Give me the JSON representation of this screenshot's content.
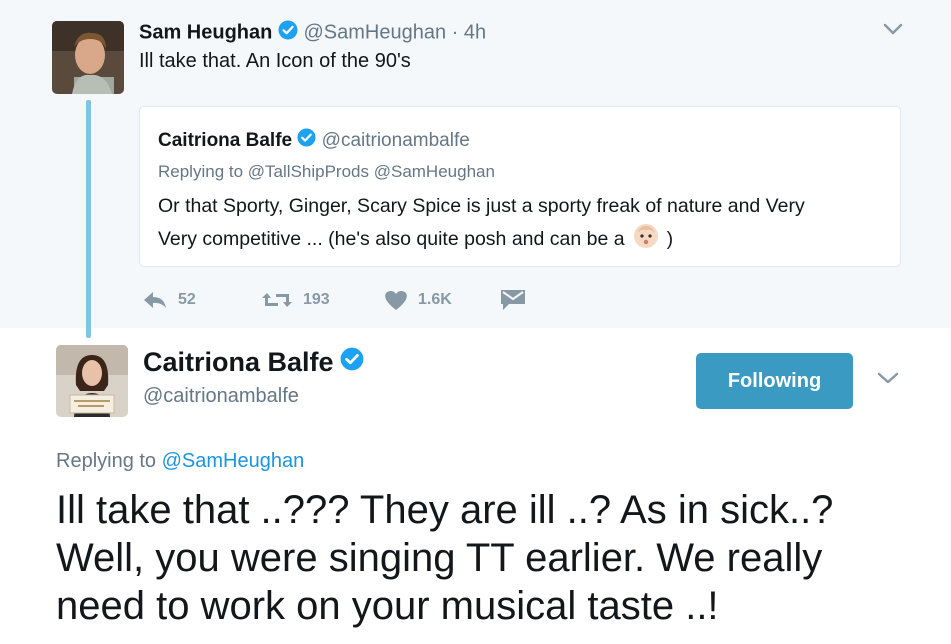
{
  "top_tweet": {
    "author_name": "Sam Heughan",
    "author_handle": "@SamHeughan",
    "time": "· 4h",
    "text": "Ill take that. An Icon of the 90's",
    "avatar_icon": "profile-photo-man"
  },
  "quoted_tweet": {
    "author_name": "Caitriona Balfe",
    "author_handle": "@caitrionambalfe",
    "replying_prefix": "Replying to",
    "replying_handles": "@TallShipProds @SamHeughan",
    "text_line1": "Or that Sporty, Ginger, Scary Spice is just a sporty freak of nature and Very",
    "text_line2": "Very competitive ... (he's also quite posh and can be a",
    "emoji_icon": "baby-face-emoji",
    "text_end": ")"
  },
  "actions": {
    "reply_count": "52",
    "retweet_count": "193",
    "like_count": "1.6K"
  },
  "main_tweet": {
    "author_name": "Caitriona Balfe",
    "author_handle": "@caitrionambalfe",
    "follow_label": "Following",
    "replying_prefix": "Replying to",
    "replying_handle": "@SamHeughan",
    "text_line1": "Ill take that ..??? They are ill ..? As in sick..?",
    "text_line2": "Well, you were singing TT earlier. We really",
    "text_line3": "need to work on your musical taste ..!",
    "avatar_icon": "profile-photo-woman"
  },
  "colors": {
    "link": "#1b95e0",
    "verified": "#1da1f2",
    "follow_button": "#3a9ac2",
    "thread_line": "#7fc5e0",
    "muted": "#657786"
  }
}
